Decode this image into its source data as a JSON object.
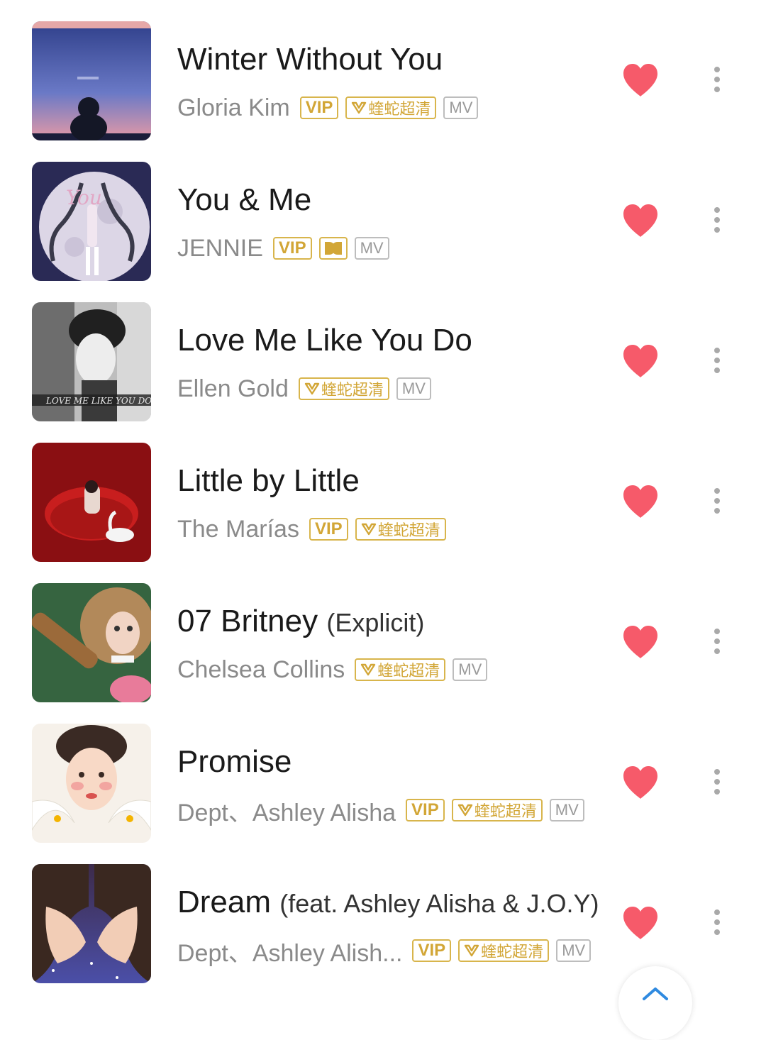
{
  "songs": [
    {
      "title": "Winter Without You",
      "title_suffix": "",
      "artist": "Gloria Kim",
      "tags": [
        "VIP",
        "蝰蛇超清",
        "MV"
      ]
    },
    {
      "title": "You & Me",
      "title_suffix": "",
      "artist": "JENNIE",
      "tags": [
        "VIP",
        "dolby",
        "MV"
      ]
    },
    {
      "title": "Love Me Like You Do",
      "title_suffix": "",
      "artist": "Ellen Gold",
      "tags": [
        "蝰蛇超清",
        "MV"
      ]
    },
    {
      "title": "Little by Little",
      "title_suffix": "",
      "artist": "The Marías",
      "tags": [
        "VIP",
        "蝰蛇超清"
      ]
    },
    {
      "title": "07 Britney",
      "title_suffix": "(Explicit)",
      "artist": "Chelsea Collins",
      "tags": [
        "蝰蛇超清",
        "MV"
      ]
    },
    {
      "title": "Promise",
      "title_suffix": "",
      "artist": "Dept、Ashley Alisha",
      "tags": [
        "VIP",
        "蝰蛇超清",
        "MV"
      ]
    },
    {
      "title": "Dream",
      "title_suffix": "(feat. Ashley Alisha & J.O.Y)",
      "artist": "Dept、Ashley Alish...",
      "tags": [
        "VIP",
        "蝰蛇超清",
        "MV"
      ]
    }
  ],
  "tag_labels": {
    "vip": "VIP",
    "viper_hd": "蝰蛇超清",
    "mv": "MV"
  },
  "icons": {
    "favorite": "heart-icon",
    "more": "more-vertical-icon",
    "scroll_top": "arrow-up-icon"
  },
  "colors": {
    "heart": "#f65a6a",
    "tag_gold": "#d2a636",
    "tag_grey": "#9a9a9a"
  }
}
